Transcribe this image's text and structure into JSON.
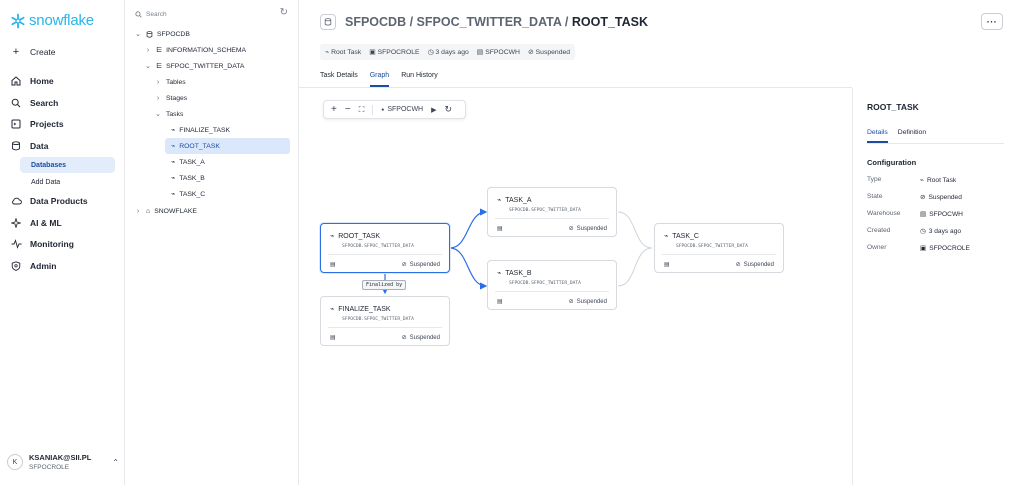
{
  "nav": {
    "brand": "snowflake",
    "create": "Create",
    "items": [
      {
        "label": "Home",
        "icon": "home-icon"
      },
      {
        "label": "Search",
        "icon": "search-icon"
      },
      {
        "label": "Projects",
        "icon": "projects-icon"
      },
      {
        "label": "Data",
        "icon": "database-icon"
      },
      {
        "label": "Data Products",
        "icon": "cloud-icon"
      },
      {
        "label": "AI & ML",
        "icon": "sparkle-icon"
      },
      {
        "label": "Monitoring",
        "icon": "pulse-icon"
      },
      {
        "label": "Admin",
        "icon": "shield-icon"
      }
    ],
    "data_sub": [
      "Databases",
      "Add Data"
    ],
    "user": {
      "initial": "K",
      "name": "KSANIAK@SII.PL",
      "role": "SFPOCROLE"
    }
  },
  "tree": {
    "search_placeholder": "Search",
    "rows": [
      "SFPOCDB",
      "INFORMATION_SCHEMA",
      "SFPOC_TWITTER_DATA",
      "Tables",
      "Stages",
      "Tasks",
      "FINALIZE_TASK",
      "ROOT_TASK",
      "TASK_A",
      "TASK_B",
      "TASK_C",
      "SNOWFLAKE"
    ]
  },
  "header": {
    "path": "SFPOCDB / SFPOC_TWITTER_DATA / ",
    "name": "ROOT_TASK",
    "more": "···",
    "meta": [
      "Root Task",
      "SFPOCROLE",
      "3 days ago",
      "SFPOCWH",
      "Suspended"
    ]
  },
  "tabs": [
    "Task Details",
    "Graph",
    "Run History"
  ],
  "toolbar": {
    "warehouse": "SFPOCWH"
  },
  "graph": {
    "nodes": [
      {
        "name": "ROOT_TASK",
        "path": "SFPOCDB.SFPOC_TWITTER_DATA",
        "status": "Suspended"
      },
      {
        "name": "FINALIZE_TASK",
        "path": "SFPOCDB.SFPOC_TWITTER_DATA",
        "status": "Suspended"
      },
      {
        "name": "TASK_A",
        "path": "SFPOCDB.SFPOC_TWITTER_DATA",
        "status": "Suspended"
      },
      {
        "name": "TASK_B",
        "path": "SFPOCDB.SFPOC_TWITTER_DATA",
        "status": "Suspended"
      },
      {
        "name": "TASK_C",
        "path": "SFPOCDB.SFPOC_TWITTER_DATA",
        "status": "Suspended"
      }
    ],
    "finalized_label": "Finalized by"
  },
  "panel": {
    "title": "ROOT_TASK",
    "tabs": [
      "Details",
      "Definition"
    ],
    "section": "Configuration",
    "rows": [
      {
        "k": "Type",
        "v": "Root Task"
      },
      {
        "k": "State",
        "v": "Suspended"
      },
      {
        "k": "Warehouse",
        "v": "SFPOCWH"
      },
      {
        "k": "Created",
        "v": "3 days ago"
      },
      {
        "k": "Owner",
        "v": "SFPOCROLE"
      }
    ]
  }
}
